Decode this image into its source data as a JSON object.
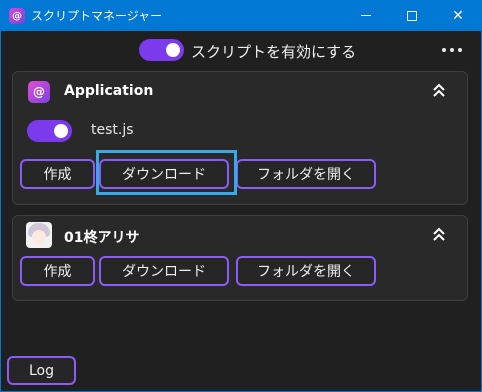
{
  "window": {
    "title": "スクリプトマネージャー",
    "app_icon_glyph": "@",
    "controls": {
      "minimize": "–",
      "maximize": "□",
      "close": "✕"
    }
  },
  "main": {
    "enable_label": "スクリプトを有効にする",
    "enable_toggle_on": true
  },
  "cards": [
    {
      "title": "Application",
      "icon": "app-logo-icon",
      "icon_glyph": "@",
      "collapse_icon": "double-chevron-up-icon",
      "script": {
        "name": "test.js",
        "enabled": true
      },
      "buttons": {
        "create": "作成",
        "download": "ダウンロード",
        "open_folder": "フォルダを開く"
      }
    },
    {
      "title": "01柊アリサ",
      "icon": "character-avatar-icon",
      "collapse_icon": "double-chevron-up-icon",
      "buttons": {
        "create": "作成",
        "download": "ダウンロード",
        "open_folder": "フォルダを開く"
      }
    }
  ],
  "footer": {
    "log_label": "Log"
  },
  "colors": {
    "titlebar": "#0078d4",
    "background": "#202020",
    "card": "#292929",
    "accent": "#8b5cf6",
    "toggle_on": "#7c3aed",
    "highlight": "#38a8e8"
  }
}
